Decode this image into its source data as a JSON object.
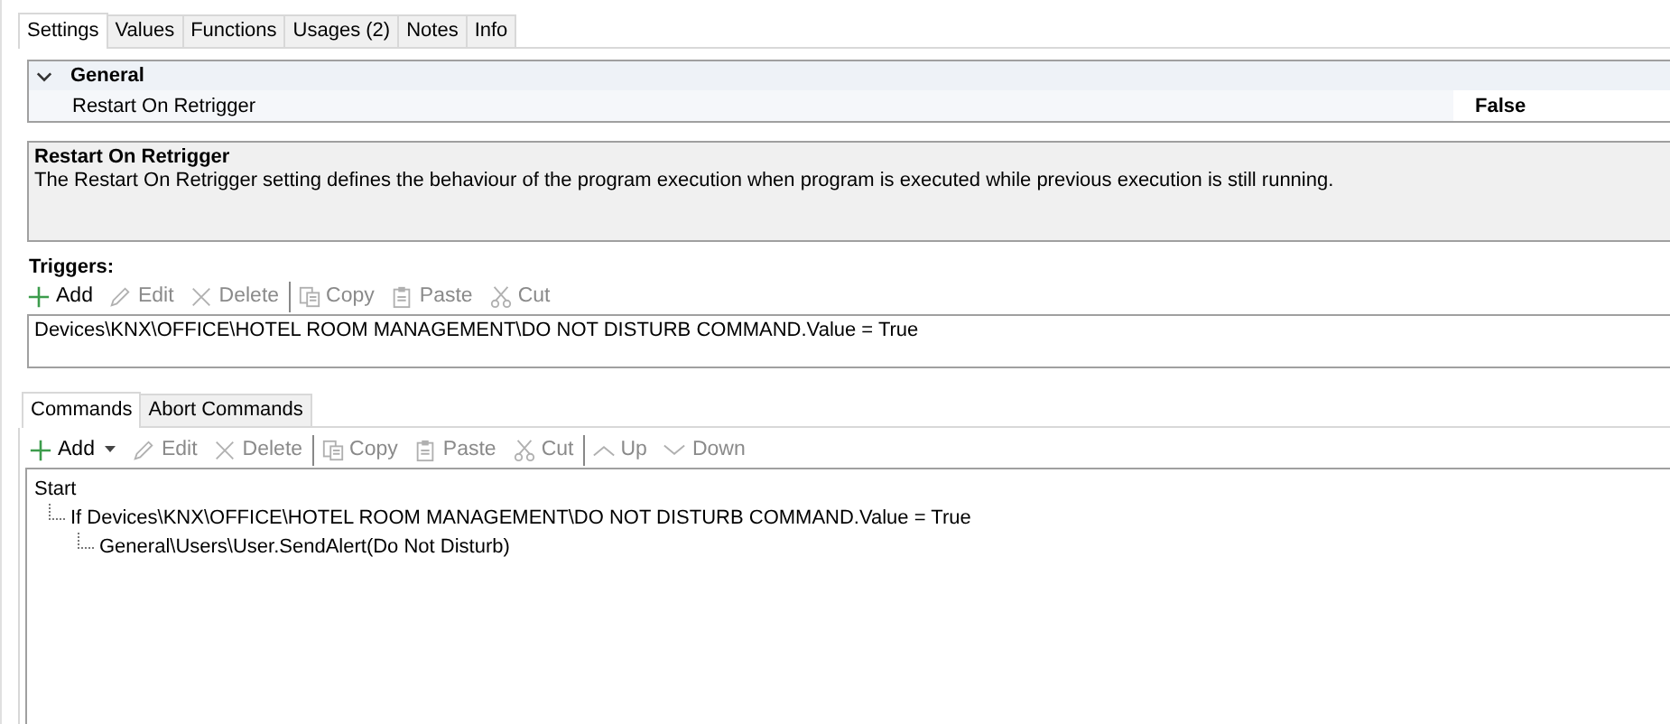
{
  "tabs": [
    {
      "label": "Settings",
      "selected": true
    },
    {
      "label": "Values",
      "selected": false
    },
    {
      "label": "Functions",
      "selected": false
    },
    {
      "label": "Usages (2)",
      "selected": false
    },
    {
      "label": "Notes",
      "selected": false
    },
    {
      "label": "Info",
      "selected": false
    }
  ],
  "property_grid": {
    "group": {
      "title": "General",
      "expanded": true,
      "rows": [
        {
          "label": "Restart On Retrigger",
          "value": "False"
        }
      ]
    }
  },
  "description": {
    "title": "Restart On Retrigger",
    "text": "The Restart On Retrigger setting defines the behaviour of the program execution when program is executed while previous execution is still running."
  },
  "triggers": {
    "label": "Triggers:",
    "toolbar": [
      [
        {
          "kind": "plus",
          "label": "Add",
          "disabled": false,
          "dropdown": false
        },
        {
          "kind": "pencil",
          "label": "Edit",
          "disabled": true,
          "dropdown": false
        },
        {
          "kind": "cross",
          "label": "Delete",
          "disabled": true,
          "dropdown": false
        }
      ],
      [
        {
          "kind": "copy",
          "label": "Copy",
          "disabled": true,
          "dropdown": false
        },
        {
          "kind": "paste",
          "label": "Paste",
          "disabled": true,
          "dropdown": false
        },
        {
          "kind": "scissors",
          "label": "Cut",
          "disabled": true,
          "dropdown": false
        }
      ]
    ],
    "items": [
      "Devices\\KNX\\OFFICE\\HOTEL ROOM MANAGEMENT\\DO NOT DISTURB COMMAND.Value = True"
    ]
  },
  "command_tabs": [
    {
      "label": "Commands",
      "selected": true
    },
    {
      "label": "Abort Commands",
      "selected": false
    }
  ],
  "commands": {
    "toolbar": [
      [
        {
          "kind": "plus",
          "label": "Add",
          "disabled": false,
          "dropdown": true
        },
        {
          "kind": "pencil",
          "label": "Edit",
          "disabled": true,
          "dropdown": false
        },
        {
          "kind": "cross",
          "label": "Delete",
          "disabled": true,
          "dropdown": false
        }
      ],
      [
        {
          "kind": "copy",
          "label": "Copy",
          "disabled": true,
          "dropdown": false
        },
        {
          "kind": "paste",
          "label": "Paste",
          "disabled": true,
          "dropdown": false
        },
        {
          "kind": "scissors",
          "label": "Cut",
          "disabled": true,
          "dropdown": false
        }
      ],
      [
        {
          "kind": "up",
          "label": "Up",
          "disabled": true,
          "dropdown": false
        },
        {
          "kind": "down",
          "label": "Down",
          "disabled": true,
          "dropdown": false
        }
      ]
    ],
    "tree": [
      {
        "label": "Start",
        "children": [
          {
            "label": "If Devices\\KNX\\OFFICE\\HOTEL ROOM MANAGEMENT\\DO NOT DISTURB COMMAND.Value = True",
            "children": [
              {
                "label": "General\\Users\\User.SendAlert(Do Not Disturb)"
              }
            ]
          }
        ]
      }
    ]
  }
}
